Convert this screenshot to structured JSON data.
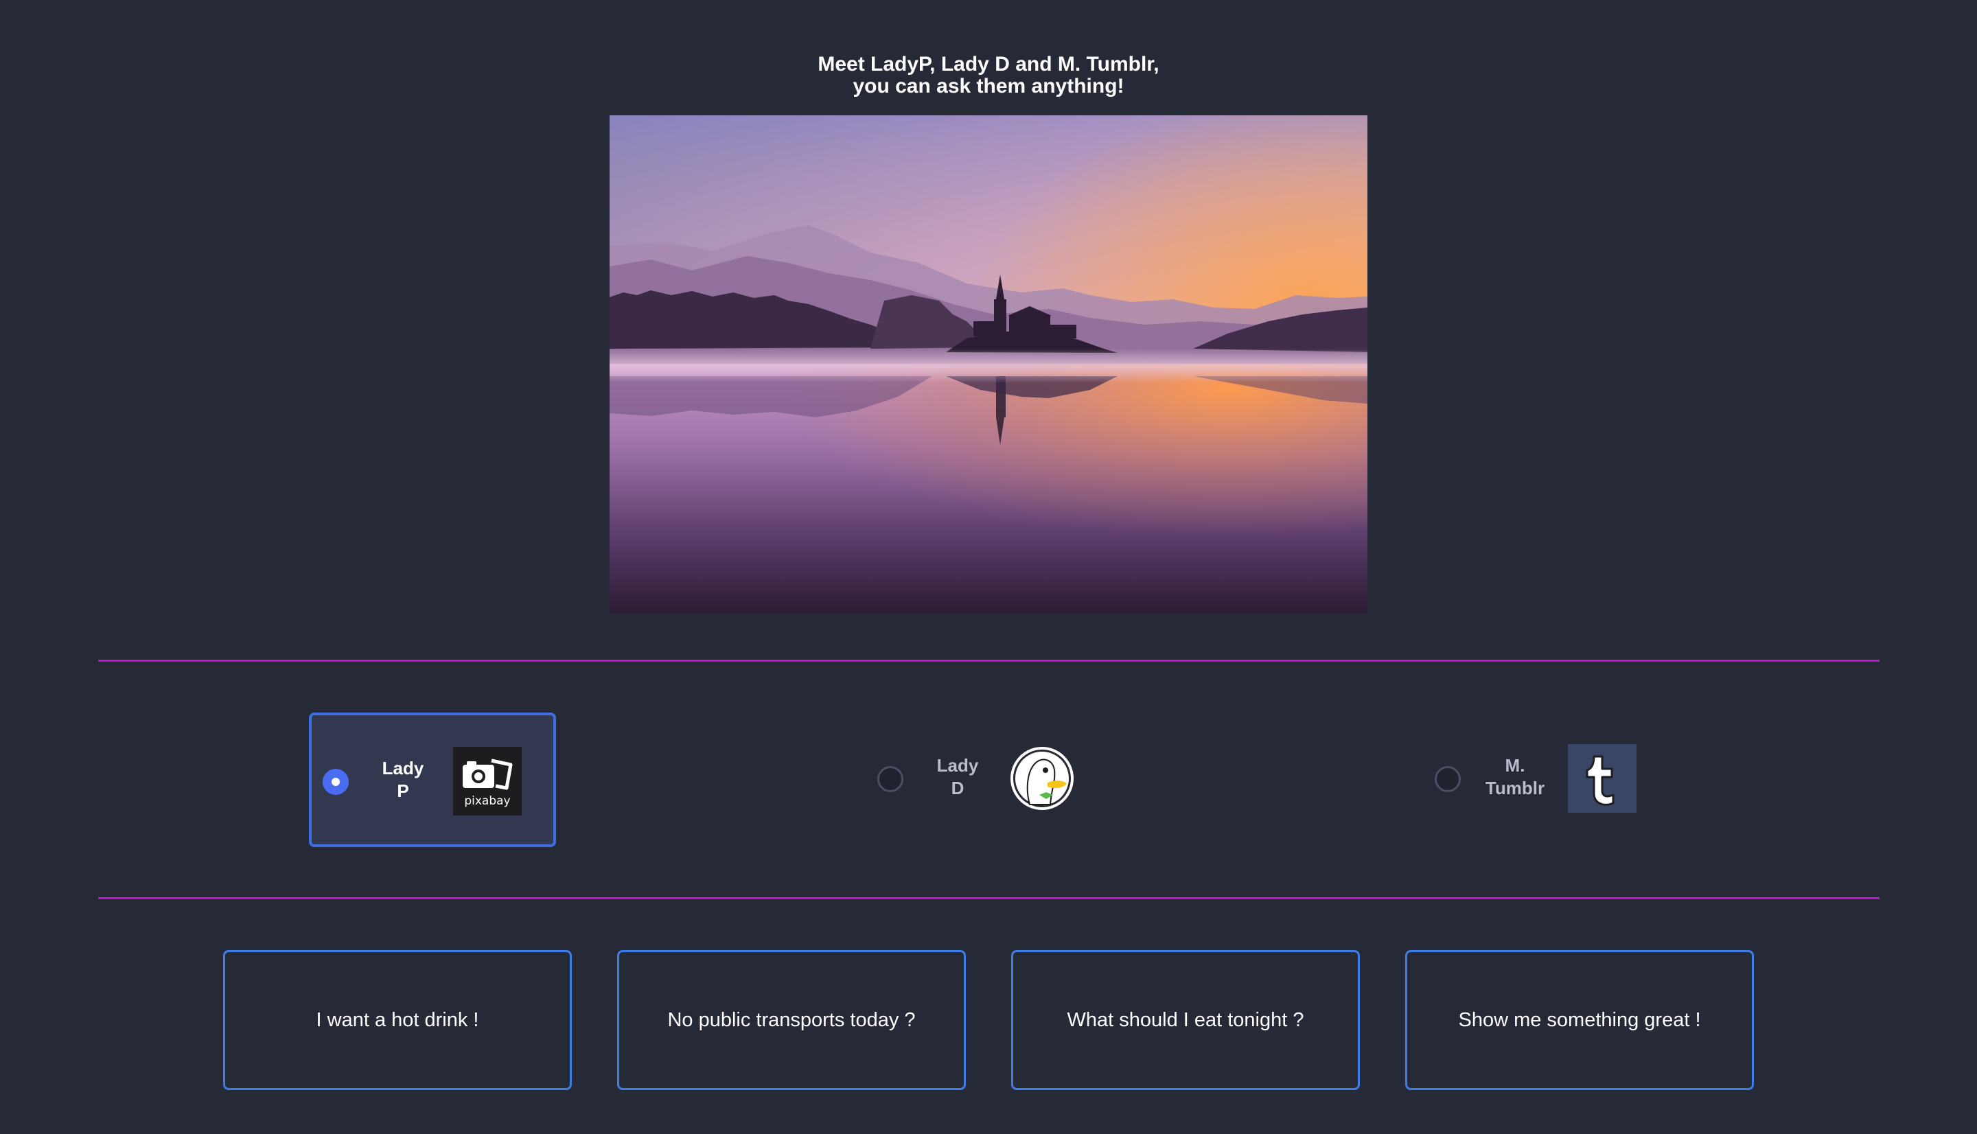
{
  "header": {
    "line1": "Meet LadyP, Lady D and M. Tumblr,",
    "line2": "you can ask them anything!"
  },
  "hero_image": {
    "description_icon": "lake-sunset-image"
  },
  "personas": [
    {
      "line1": "Lady",
      "line2": "P",
      "logo": "pixabay-logo",
      "logo_text": "pixabay",
      "selected": true
    },
    {
      "line1": "Lady",
      "line2": "D",
      "logo": "duckduckgo-logo",
      "selected": false
    },
    {
      "line1": "M.",
      "line2": "Tumblr",
      "logo": "tumblr-logo",
      "selected": false
    }
  ],
  "suggestions": [
    "I want a hot drink !",
    "No public transports today ?",
    "What should I eat tonight ?",
    "Show me something great !"
  ],
  "colors": {
    "background": "#262936",
    "divider": "#c312d0",
    "accent": "#3f6fe0",
    "radio_selected": "#4a6cf0"
  }
}
